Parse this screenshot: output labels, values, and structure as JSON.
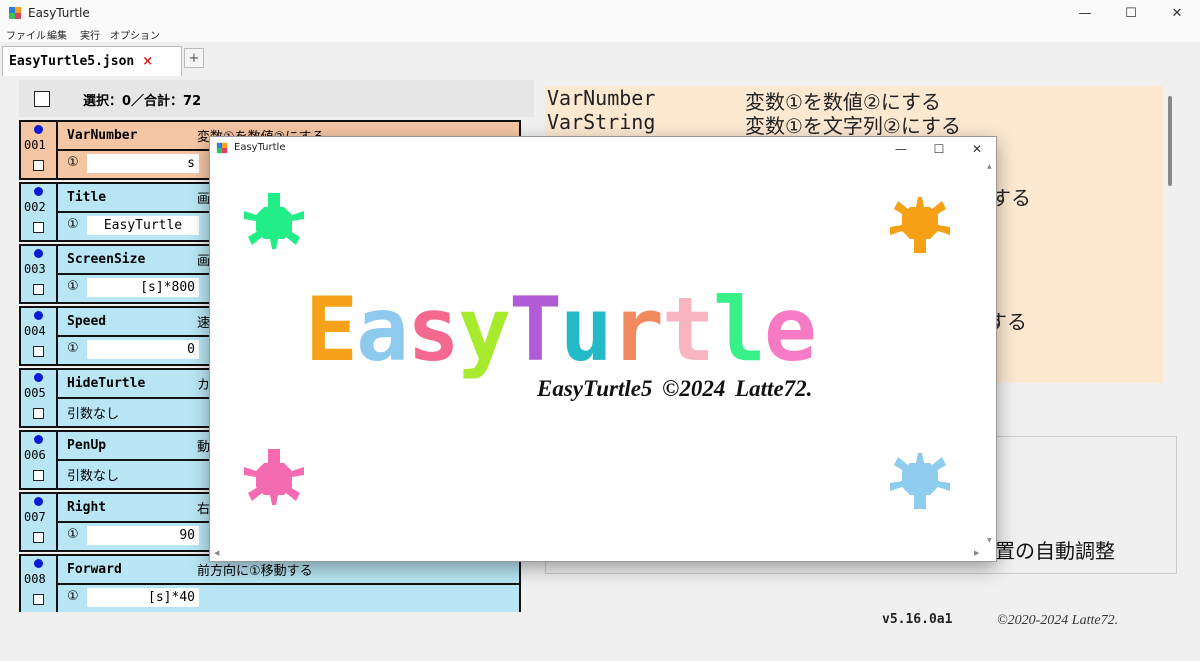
{
  "main_window": {
    "title": "EasyTurtle",
    "minimize": "—",
    "maximize": "☐",
    "close": "✕"
  },
  "menu": [
    "ファイル",
    "編集",
    "実行",
    "オプション"
  ],
  "tab": {
    "file_name": "EasyTurtle5.json",
    "close": "×",
    "add": "+"
  },
  "selection": {
    "text": "選択：0／合計：72"
  },
  "commands": [
    {
      "num": "001",
      "name": "VarNumber",
      "desc": "変数①を数値②にする",
      "arg_mark": "①",
      "arg": "s",
      "selected": true
    },
    {
      "num": "002",
      "name": "Title",
      "desc": "画",
      "arg_mark": "①",
      "arg": "EasyTurtle",
      "selected": false
    },
    {
      "num": "003",
      "name": "ScreenSize",
      "desc": "画",
      "arg_mark": "①",
      "arg": "[s]*800",
      "selected": false
    },
    {
      "num": "004",
      "name": "Speed",
      "desc": "速",
      "arg_mark": "①",
      "arg": "0",
      "selected": false
    },
    {
      "num": "005",
      "name": "HideTurtle",
      "desc": "カ",
      "no_arg": "引数なし",
      "selected": false
    },
    {
      "num": "006",
      "name": "PenUp",
      "desc": "動",
      "no_arg": "引数なし",
      "selected": false
    },
    {
      "num": "007",
      "name": "Right",
      "desc": "右",
      "arg_mark": "①",
      "arg": "90",
      "selected": false
    },
    {
      "num": "008",
      "name": "Forward",
      "desc": "前方向に①移動する",
      "arg_mark": "①",
      "arg": "[s]*40",
      "selected": false
    }
  ],
  "help": [
    {
      "key": "VarNumber",
      "value": "変数①を数値②にする"
    },
    {
      "key": "VarString",
      "value": "変数①を文字列②にする"
    },
    {
      "key": "",
      "value": "する"
    },
    {
      "key": "",
      "value": "動する"
    }
  ],
  "options": {
    "auto_adjust": "置の自動調整"
  },
  "footer": {
    "version": "v5.16.0a1",
    "copyright": "©2020-2024 Latte72."
  },
  "dialog": {
    "title": "EasyTurtle",
    "minimize": "—",
    "maximize": "☐",
    "close": "✕",
    "logo_letters": [
      {
        "ch": "E",
        "color": "#f5a21a"
      },
      {
        "ch": "a",
        "color": "#8ec9ee"
      },
      {
        "ch": "s",
        "color": "#f6698f"
      },
      {
        "ch": "y",
        "color": "#a8ea2e"
      },
      {
        "ch": "T",
        "color": "#b25bd6"
      },
      {
        "ch": "u",
        "color": "#23b9c7"
      },
      {
        "ch": "r",
        "color": "#f28a5f"
      },
      {
        "ch": "t",
        "color": "#f8b4bf"
      },
      {
        "ch": "l",
        "color": "#38f089"
      },
      {
        "ch": "e",
        "color": "#f67bc4"
      }
    ],
    "subtitle": "EasyTurtle5   ©2024 Latte72.",
    "turtle_colors": {
      "top_left": "#22ee88",
      "top_right": "#f5a015",
      "bottom_left": "#f46bb4",
      "bottom_right": "#8ecdee"
    }
  }
}
